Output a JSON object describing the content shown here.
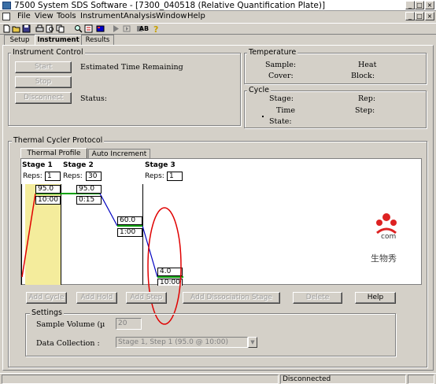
{
  "window": {
    "title": "7500 System SDS Software - [7300_040518 (Relative Quantification Plate)]",
    "controls": [
      "_",
      "□",
      "×"
    ],
    "doc_controls": [
      "_",
      "□",
      "×"
    ]
  },
  "menu": [
    "File",
    "View",
    "Tools",
    "Instrument",
    "Analysis",
    "Window",
    "Help"
  ],
  "toolbar": {
    "text_icon": "AB"
  },
  "main_tabs": [
    "Setup",
    "Instrument",
    "Results"
  ],
  "instrument_control": {
    "label": "Instrument Control",
    "start": "Start",
    "stop": "Stop",
    "disconnect": "Disconnect",
    "estimated_time": "Estimated Time Remaining",
    "status": "Status:"
  },
  "temperature": {
    "label": "Temperature",
    "sample": "Sample:",
    "cover": "Cover:",
    "heat": "Heat",
    "block": "Block:"
  },
  "cycle": {
    "label": "Cycle",
    "stage": "Stage:",
    "rep": "Rep:",
    "time": "Time",
    "step": "Step:",
    "state": "State:"
  },
  "protocol": {
    "label": "Thermal Cycler Protocol",
    "tabs": [
      "Thermal Profile",
      "Auto Increment"
    ],
    "stages": [
      {
        "name": "Stage 1",
        "reps_label": "Reps:",
        "reps": "1",
        "temp": "95.0",
        "time": "10:00"
      },
      {
        "name": "Stage 2",
        "reps_label": "Reps:",
        "reps": "30",
        "temp1": "95.0",
        "time1": "0:15",
        "temp2": "60.0",
        "time2": "1:00"
      },
      {
        "name": "Stage 3",
        "reps_label": "Reps:",
        "reps": "1",
        "temp": "4.0",
        "time": "10:00"
      }
    ],
    "watermark": {
      "text": "com",
      "cn": "生物秀"
    },
    "buttons": {
      "add_cycle": "Add Cycle",
      "add_hold": "Add Hold",
      "add_step": "Add Step",
      "add_dissociation": "Add Dissociation Stage",
      "delete": "Delete",
      "help": "Help"
    },
    "settings": {
      "label": "Settings",
      "sample_volume_label": "Sample Volume (µ",
      "sample_volume": "20",
      "data_collection_label": "Data Collection :",
      "data_collection": "Stage 1, Step 1 (95.0 @ 10:00)"
    }
  },
  "status": {
    "connection": "Disconnected"
  },
  "colors": {
    "stage1_fill": "#f4ec9c",
    "hold_line": "#00a000",
    "ramp_line": "#0000c0",
    "up_ramp": "#e00000",
    "annotation": "#e00000"
  }
}
